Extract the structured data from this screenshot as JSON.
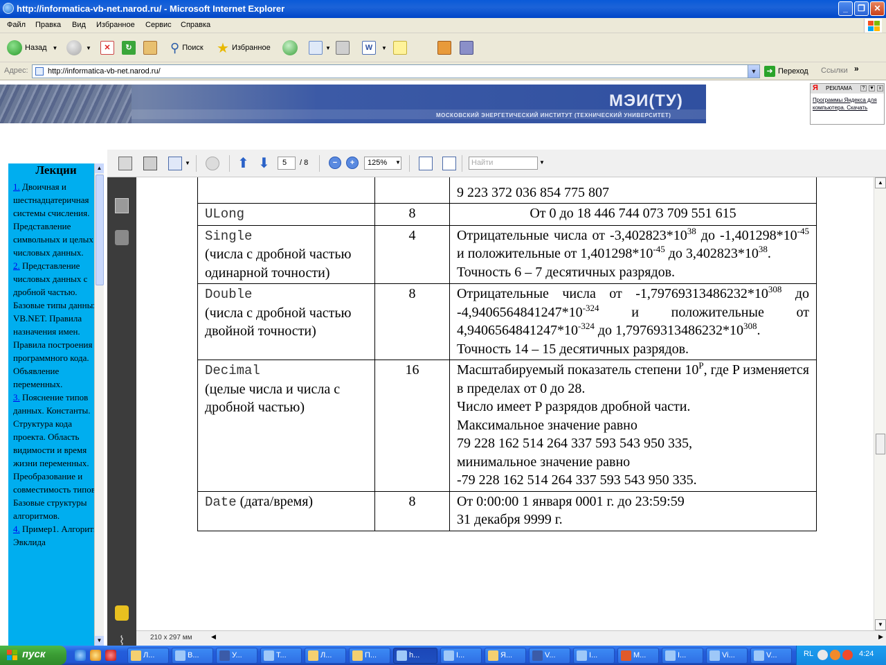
{
  "window": {
    "title": "http://informatica-vb-net.narod.ru/ - Microsoft Internet Explorer",
    "minimize": "_",
    "maximize": "❐",
    "close": "✕"
  },
  "menu": [
    "Файл",
    "Правка",
    "Вид",
    "Избранное",
    "Сервис",
    "Справка"
  ],
  "toolbar": {
    "back": "Назад",
    "search": "Поиск",
    "favorites": "Избранное"
  },
  "address": {
    "label": "Адрес:",
    "url": "http://informatica-vb-net.narod.ru/",
    "go": "Переход",
    "links": "Ссылки",
    "more": "»"
  },
  "banner": {
    "title": "МЭИ(ТУ)",
    "subtitle": "МОСКОВСКИЙ ЭНЕРГЕТИЧЕСКИЙ ИНСТИТУТ (ТЕХНИЧЕСКИЙ УНИВЕРСИТЕТ)"
  },
  "yandex_ad": {
    "logo": "Я",
    "label": "РЕКЛАМА",
    "text": "Программы Яндекса для компьютера. Скачать"
  },
  "lectures": {
    "heading": "Лекции",
    "items": [
      {
        "num": "1.",
        "text": " Двоичная и шестнадцатеричная системы счисления. Представление символьных и целых числовых данных."
      },
      {
        "num": "2.",
        "text": " Представление числовых данных с дробной частью. Базовые типы данных VB.NET. Правила назначения имен. Правила построения программного кода. Объявление переменных."
      },
      {
        "num": "3.",
        "text": " Пояснение типов данных. Константы. Структура кода проекта. Область видимости и время жизни переменных. Преобразование и совместимость типов. Базовые структуры алгоритмов."
      },
      {
        "num": "4.",
        "text": " Пример1. Алгоритм Эвклида"
      }
    ]
  },
  "pdf": {
    "page": "5",
    "page_total": "/ 8",
    "zoom": "125%",
    "find_placeholder": "Найти",
    "paper_size": "210 x 297 мм",
    "rows": [
      {
        "type": "",
        "desc": "",
        "size": "",
        "range": "9 223 372 036 854 775 807"
      },
      {
        "type": "ULong",
        "desc": "",
        "size": "8",
        "range": "От 0 до 18 446 744 073 709 551 615"
      },
      {
        "type": "Single",
        "desc": "(числа с дробной частью одинарной точности)",
        "size": "4",
        "range_parts": [
          "Отрицательные числа от -3,402823*10",
          "38",
          " до -1,401298*10",
          "-45",
          " и положительные от 1,401298*10",
          "-45",
          " до 3,402823*10",
          "38",
          "."
        ],
        "precision": "Точность 6 – 7 десятичных разрядов."
      },
      {
        "type": "Double",
        "desc": "(числа с дробной частью двойной точности)",
        "size": "8",
        "range_parts": [
          "Отрицательные числа от -1,79769313486232*10",
          "308",
          " до -4,9406564841247*10",
          "-324",
          " и положительные от 4,9406564841247*10",
          "-324",
          " до 1,79769313486232*10",
          "308",
          "."
        ],
        "precision": "Точность 14 – 15 десятичных разрядов."
      },
      {
        "type": "Decimal",
        "desc": "(целые числа и числа с дробной частью)",
        "size": "16",
        "range_parts": [
          "Масштабируемый показатель степени 10",
          "P",
          ", где P изменяется в пределах от 0 до 28."
        ],
        "lines": [
          "Число имеет P разрядов дробной части.",
          "Максимальное значение равно",
          "79 228 162 514 264 337 593 543 950 335,",
          "минимальное значение равно",
          "-79 228 162 514 264 337 593 543 950 335."
        ]
      },
      {
        "type": "Date",
        "desc": "(дата/время)",
        "size": "8",
        "lines": [
          "От 0:00:00 1 января 0001 г. до 23:59:59",
          "31 декабря 9999 г."
        ]
      }
    ]
  },
  "taskbar": {
    "start": "пуск",
    "buttons": [
      "Л...",
      "В...",
      "У...",
      "Т...",
      "Л...",
      "П...",
      "h...",
      "I...",
      "Я...",
      "V...",
      "I...",
      "М...",
      "I...",
      "Vi...",
      "V..."
    ],
    "lang": "RL",
    "clock": "4:24"
  },
  "colors": {
    "xp_blue": "#0a5ad8",
    "lectures_bg": "#00aeef",
    "start_green": "#3a9b33",
    "pdf_sidebar": "#3c3c3c"
  }
}
